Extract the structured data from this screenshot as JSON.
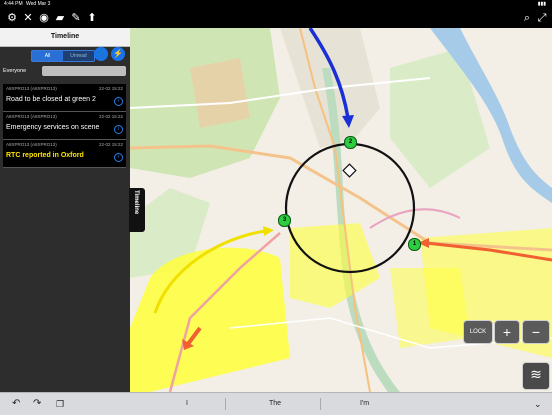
{
  "status": {
    "time": "4:44 PM",
    "date": "Wed Mar 3"
  },
  "toolbar": {
    "left_icons": [
      "settings-icon",
      "satellite-icon",
      "target-icon",
      "chat-icon",
      "tools-icon",
      "upload-icon"
    ],
    "right_icons": [
      "search-icon",
      "fullscreen-icon"
    ]
  },
  "panel": {
    "title": "Timeline",
    "filter_all": "All",
    "filter_unread": "Unread",
    "everyone_label": "Everyone",
    "messages": [
      {
        "source": "A8XPRO13 (A8XPRO13)",
        "time": "22-02 15:22",
        "text": "Road to be closed at green 2",
        "alert": false
      },
      {
        "source": "A8XPRO13 (A8XPRO13)",
        "time": "22-02 15:22",
        "text": "Emergency services on scene",
        "alert": false
      },
      {
        "source": "A8XPRO13 (A8XPRO13)",
        "time": "22-02 15:22",
        "text": "RTC reported in Oxford",
        "alert": true
      }
    ]
  },
  "side_tab": "Timeline",
  "map": {
    "markers": [
      {
        "label": "1",
        "color": "#2ecc40"
      },
      {
        "label": "2",
        "color": "#2ecc40"
      },
      {
        "label": "3",
        "color": "#2ecc40"
      }
    ],
    "lock_label": "LOCK",
    "zoom_in": "+",
    "zoom_out": "−",
    "colors": {
      "road_yellow": "#ffff3a",
      "park_green": "#cfe6b4",
      "water": "#a6cbe8",
      "arrow_blue": "#1a2fd6",
      "arrow_orange": "#f06030",
      "arrow_yellow": "#f0e000"
    }
  },
  "keyboard_bar": {
    "suggestions": [
      "I",
      "The",
      "I'm"
    ]
  }
}
